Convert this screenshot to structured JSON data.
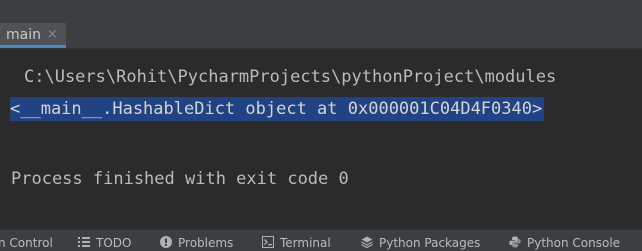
{
  "tab": {
    "label": "main",
    "close_glyph": "×"
  },
  "console": {
    "cut_line": "…",
    "path_line": "C:\\Users\\Rohit\\PycharmProjects\\pythonProject\\modules",
    "selected_line": "<__main__.HashableDict object at 0x000001C04D4F0340>",
    "process_line": "Process finished with exit code 0"
  },
  "bottombar": {
    "items": [
      {
        "label": "n Control",
        "icon": "none"
      },
      {
        "label": "TODO",
        "icon": "todo-list-icon"
      },
      {
        "label": "Problems",
        "icon": "problems-info-icon"
      },
      {
        "label": "Terminal",
        "icon": "terminal-icon"
      },
      {
        "label": "Python Packages",
        "icon": "layers-icon"
      },
      {
        "label": "Python Console",
        "icon": "python-icon"
      }
    ]
  },
  "colors": {
    "selection": "#214283",
    "tab_underline": "#4a88c7",
    "background": "#2b2b2b",
    "text": "#bbbbbb"
  }
}
